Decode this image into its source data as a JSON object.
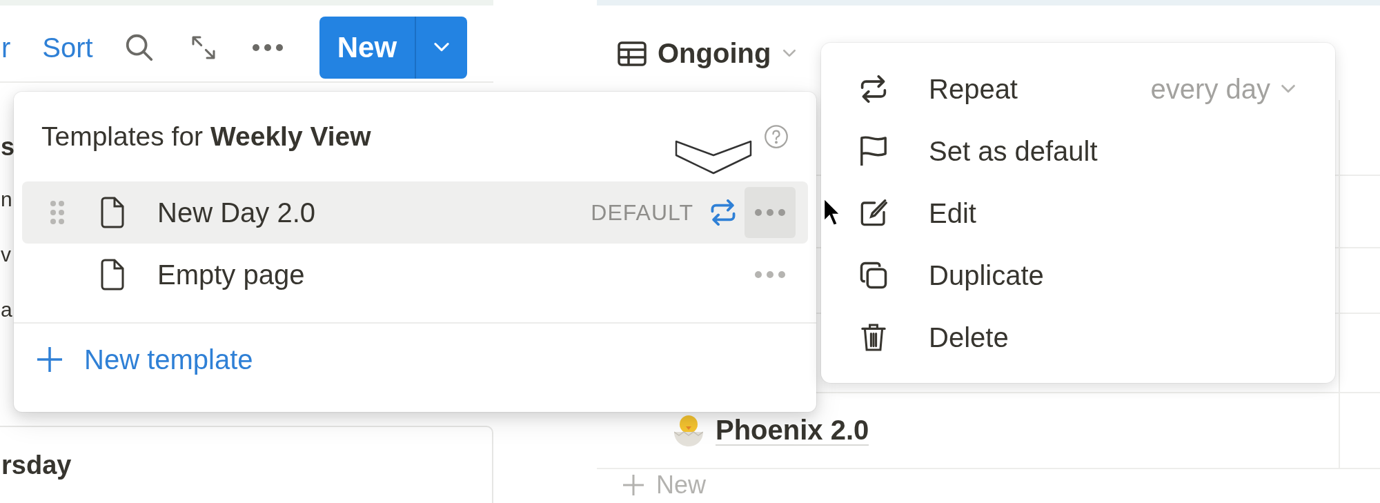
{
  "toolbar": {
    "filter_label": "r",
    "sort_label": "Sort",
    "new_button": "New"
  },
  "left_fragments": [
    "s",
    "n",
    "v",
    "a"
  ],
  "left_card": {
    "title": "rsday"
  },
  "view": {
    "name": "Ongoing"
  },
  "table_rows": [
    {
      "title": "Phoenix 2.0"
    }
  ],
  "add_row": "New",
  "templates_popup": {
    "title": "Templates for **Weekly View**",
    "items": [
      {
        "name": "New Day 2.0",
        "badge": "DEFAULT",
        "repeat": true,
        "selected": true
      },
      {
        "name": "Empty page",
        "repeat": false,
        "selected": false
      }
    ],
    "new_template": "New template"
  },
  "context_menu": {
    "items": [
      {
        "kind": "repeat",
        "label": "Repeat",
        "value": "every day"
      },
      {
        "kind": "default",
        "label": "Set as default"
      },
      {
        "kind": "edit",
        "label": "Edit"
      },
      {
        "kind": "duplicate",
        "label": "Duplicate"
      },
      {
        "kind": "delete",
        "label": "Delete"
      }
    ]
  }
}
